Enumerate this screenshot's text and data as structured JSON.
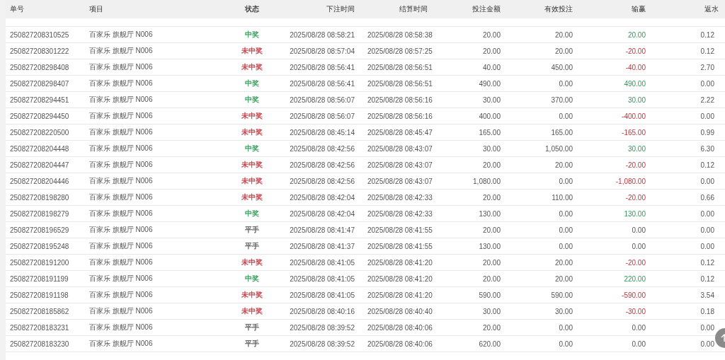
{
  "table": {
    "columns": [
      "单号",
      "项目",
      "状态",
      "下注时间",
      "结算时间",
      "投注金额",
      "有效投注",
      "输赢",
      "返水"
    ],
    "rows": [
      {
        "id": "250827208310525",
        "game": "百家乐 旗舰厅 N006",
        "status": "中奖",
        "color": "#2e9a55",
        "bet_time": "2025/08/28 08:58:21",
        "settle_time": "2025/08/28 08:58:38",
        "amount": "20.00",
        "valid": "20.00",
        "profit": "20.00",
        "rebate": "0.12"
      },
      {
        "id": "250827208301222",
        "game": "百家乐 旗舰厅 N006",
        "status": "未中奖",
        "color": "#c0343c",
        "bet_time": "2025/08/28 08:57:04",
        "settle_time": "2025/08/28 08:57:25",
        "amount": "20.00",
        "valid": "20.00",
        "profit": "-20.00",
        "rebate": "0.12"
      },
      {
        "id": "250827208298408",
        "game": "百家乐 旗舰厅 N006",
        "status": "未中奖",
        "color": "#c0343c",
        "bet_time": "2025/08/28 08:56:41",
        "settle_time": "2025/08/28 08:56:51",
        "amount": "40.00",
        "valid": "450.00",
        "profit": "-40.00",
        "rebate": "2.70"
      },
      {
        "id": "250827208298407",
        "game": "百家乐 旗舰厅 N006",
        "status": "中奖",
        "color": "#2e9a55",
        "bet_time": "2025/08/28 08:56:41",
        "settle_time": "2025/08/28 08:56:51",
        "amount": "490.00",
        "valid": "0.00",
        "profit": "490.00",
        "rebate": "0.00"
      },
      {
        "id": "250827208294451",
        "game": "百家乐 旗舰厅 N006",
        "status": "中奖",
        "color": "#2e9a55",
        "bet_time": "2025/08/28 08:56:07",
        "settle_time": "2025/08/28 08:56:16",
        "amount": "30.00",
        "valid": "370.00",
        "profit": "30.00",
        "rebate": "2.22"
      },
      {
        "id": "250827208294450",
        "game": "百家乐 旗舰厅 N006",
        "status": "未中奖",
        "color": "#c0343c",
        "bet_time": "2025/08/28 08:56:07",
        "settle_time": "2025/08/28 08:56:16",
        "amount": "400.00",
        "valid": "0.00",
        "profit": "-400.00",
        "rebate": "0.00"
      },
      {
        "id": "250827208220500",
        "game": "百家乐 旗舰厅 N006",
        "status": "未中奖",
        "color": "#c0343c",
        "bet_time": "2025/08/28 08:45:14",
        "settle_time": "2025/08/28 08:45:47",
        "amount": "165.00",
        "valid": "165.00",
        "profit": "-165.00",
        "rebate": "0.99"
      },
      {
        "id": "250827208204448",
        "game": "百家乐 旗舰厅 N006",
        "status": "中奖",
        "color": "#2e9a55",
        "bet_time": "2025/08/28 08:42:56",
        "settle_time": "2025/08/28 08:43:07",
        "amount": "30.00",
        "valid": "1,050.00",
        "profit": "30.00",
        "rebate": "6.30"
      },
      {
        "id": "250827208204447",
        "game": "百家乐 旗舰厅 N006",
        "status": "未中奖",
        "color": "#c0343c",
        "bet_time": "2025/08/28 08:42:56",
        "settle_time": "2025/08/28 08:43:07",
        "amount": "20.00",
        "valid": "20.00",
        "profit": "-20.00",
        "rebate": "0.12"
      },
      {
        "id": "250827208204446",
        "game": "百家乐 旗舰厅 N006",
        "status": "未中奖",
        "color": "#c0343c",
        "bet_time": "2025/08/28 08:42:56",
        "settle_time": "2025/08/28 08:43:07",
        "amount": "1,080.00",
        "valid": "0.00",
        "profit": "-1,080.00",
        "rebate": "0.00"
      },
      {
        "id": "250827208198280",
        "game": "百家乐 旗舰厅 N006",
        "status": "未中奖",
        "color": "#c0343c",
        "bet_time": "2025/08/28 08:42:04",
        "settle_time": "2025/08/28 08:42:33",
        "amount": "20.00",
        "valid": "110.00",
        "profit": "-20.00",
        "rebate": "0.66"
      },
      {
        "id": "250827208198279",
        "game": "百家乐 旗舰厅 N006",
        "status": "中奖",
        "color": "#2e9a55",
        "bet_time": "2025/08/28 08:42:04",
        "settle_time": "2025/08/28 08:42:33",
        "amount": "130.00",
        "valid": "0.00",
        "profit": "130.00",
        "rebate": "0.00"
      },
      {
        "id": "250827208196529",
        "game": "百家乐 旗舰厅 N006",
        "status": "平手",
        "bet_time": "2025/08/28 08:41:47",
        "settle_time": "2025/08/28 08:41:55",
        "amount": "20.00",
        "valid": "0.00",
        "profit": "0.00",
        "rebate": "0.00"
      },
      {
        "id": "250827208195248",
        "game": "百家乐 旗舰厅 N006",
        "status": "平手",
        "bet_time": "2025/08/28 08:41:37",
        "settle_time": "2025/08/28 08:41:55",
        "amount": "130.00",
        "valid": "0.00",
        "profit": "0.00",
        "rebate": "0.00"
      },
      {
        "id": "250827208191200",
        "game": "百家乐 旗舰厅 N006",
        "status": "未中奖",
        "color": "#c0343c",
        "bet_time": "2025/08/28 08:41:05",
        "settle_time": "2025/08/28 08:41:20",
        "amount": "20.00",
        "valid": "20.00",
        "profit": "-20.00",
        "rebate": "0.12"
      },
      {
        "id": "250827208191199",
        "game": "百家乐 旗舰厅 N006",
        "status": "中奖",
        "color": "#2e9a55",
        "bet_time": "2025/08/28 08:41:05",
        "settle_time": "2025/08/28 08:41:20",
        "amount": "20.00",
        "valid": "20.00",
        "profit": "220.00",
        "rebate": "0.12"
      },
      {
        "id": "250827208191198",
        "game": "百家乐 旗舰厅 N006",
        "status": "未中奖",
        "color": "#c0343c",
        "bet_time": "2025/08/28 08:41:05",
        "settle_time": "2025/08/28 08:41:20",
        "amount": "590.00",
        "valid": "590.00",
        "profit": "-590.00",
        "rebate": "3.54"
      },
      {
        "id": "250827208185862",
        "game": "百家乐 旗舰厅 N006",
        "status": "未中奖",
        "color": "#c0343c",
        "bet_time": "2025/08/28 08:40:16",
        "settle_time": "2025/08/28 08:40:40",
        "amount": "30.00",
        "valid": "30.00",
        "profit": "-30.00",
        "rebate": "0.18"
      },
      {
        "id": "250827208183231",
        "game": "百家乐 旗舰厅 N006",
        "status": "平手",
        "bet_time": "2025/08/28 08:39:52",
        "settle_time": "2025/08/28 08:40:06",
        "amount": "20.00",
        "valid": "0.00",
        "profit": "0.00",
        "rebate": "0.00"
      },
      {
        "id": "250827208183230",
        "game": "百家乐 旗舰厅 N006",
        "status": "平手",
        "bet_time": "2025/08/28 08:39:52",
        "settle_time": "2025/08/28 08:40:06",
        "amount": "620.00",
        "valid": "0.00",
        "profit": "0.00",
        "rebate": "0.00"
      }
    ]
  }
}
